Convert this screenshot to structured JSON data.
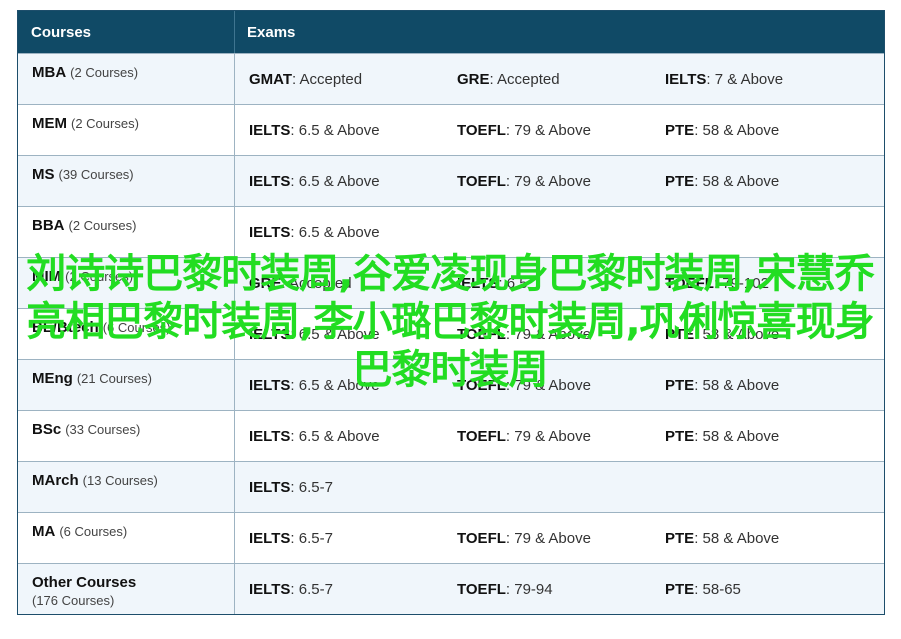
{
  "header": {
    "courses": "Courses",
    "exams": "Exams"
  },
  "rows": [
    {
      "name": "MBA",
      "count": "(2 Courses)",
      "exams": [
        {
          "k": "GMAT",
          "v": ": Accepted"
        },
        {
          "k": "GRE",
          "v": ": Accepted"
        },
        {
          "k": "IELTS",
          "v": ": 7 & Above"
        }
      ]
    },
    {
      "name": "MEM",
      "count": "(2 Courses)",
      "exams": [
        {
          "k": "IELTS",
          "v": ": 6.5 & Above"
        },
        {
          "k": "TOEFL",
          "v": ": 79 & Above"
        },
        {
          "k": "PTE",
          "v": ": 58 & Above"
        }
      ]
    },
    {
      "name": "MS",
      "count": "(39 Courses)",
      "exams": [
        {
          "k": "IELTS",
          "v": ": 6.5 & Above"
        },
        {
          "k": "TOEFL",
          "v": ": 79 & Above"
        },
        {
          "k": "PTE",
          "v": ": 58 & Above"
        }
      ]
    },
    {
      "name": "BBA",
      "count": "(2 Courses)",
      "exams": [
        {
          "k": "IELTS",
          "v": ": 6.5 & Above"
        }
      ]
    },
    {
      "name": "MIM",
      "count": "(2 Courses)",
      "exams": [
        {
          "k": "GRE",
          "v": ": Accepted"
        },
        {
          "k": "IELTS",
          "v": ": 6.5"
        },
        {
          "k": "TOEFL",
          "v": ": 79-102"
        }
      ]
    },
    {
      "name": "BE/Btech",
      "count": "(6 Courses)",
      "exams": [
        {
          "k": "IELTS",
          "v": ": 6.5 & Above"
        },
        {
          "k": "TOEFL",
          "v": ": 79 & Above"
        },
        {
          "k": "PTE",
          "v": ": 58 & Above"
        }
      ]
    },
    {
      "name": "MEng",
      "count": "(21 Courses)",
      "exams": [
        {
          "k": "IELTS",
          "v": ": 6.5 & Above"
        },
        {
          "k": "TOEFL",
          "v": ": 79 & Above"
        },
        {
          "k": "PTE",
          "v": ": 58 & Above"
        }
      ]
    },
    {
      "name": "BSc",
      "count": "(33 Courses)",
      "exams": [
        {
          "k": "IELTS",
          "v": ": 6.5 & Above"
        },
        {
          "k": "TOEFL",
          "v": ": 79 & Above"
        },
        {
          "k": "PTE",
          "v": ": 58 & Above"
        }
      ]
    },
    {
      "name": "MArch",
      "count": "(13 Courses)",
      "exams": [
        {
          "k": "IELTS",
          "v": ": 6.5-7"
        }
      ]
    },
    {
      "name": "MA",
      "count": "(6 Courses)",
      "exams": [
        {
          "k": "IELTS",
          "v": ": 6.5-7"
        },
        {
          "k": "TOEFL",
          "v": ": 79 & Above"
        },
        {
          "k": "PTE",
          "v": ": 58 & Above"
        }
      ]
    },
    {
      "name": "Other Courses",
      "count": "(176 Courses)",
      "exams": [
        {
          "k": "IELTS",
          "v": ": 6.5-7"
        },
        {
          "k": "TOEFL",
          "v": ": 79-94"
        },
        {
          "k": "PTE",
          "v": ": 58-65"
        }
      ]
    }
  ],
  "overlay_text": "刘诗诗巴黎时装周,谷爱凌现身巴黎时装周,宋慧乔亮相巴黎时装周,李小璐巴黎时装周,巩俐惊喜现身巴黎时装周",
  "colors": {
    "header_bg": "#104a66",
    "overlay": "#22dd22",
    "alt_row": "#f0f6fb"
  }
}
